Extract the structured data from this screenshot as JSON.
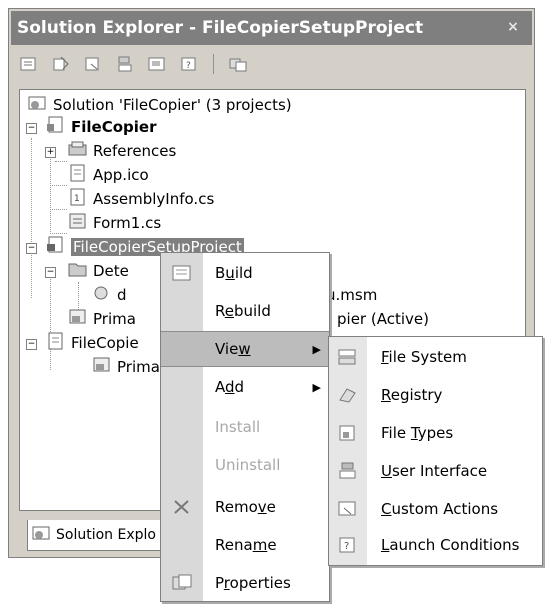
{
  "window": {
    "title": "Solution Explorer - FileCopierSetupProject",
    "close_glyph": "×"
  },
  "toolbar": {
    "icons": [
      "properties-icon",
      "show-all-files-icon",
      "refresh-icon",
      "view-code-icon",
      "view-designer-icon",
      "file-types-icon",
      "launch-conditions-icon"
    ]
  },
  "tree": {
    "solution": "Solution 'FileCopier' (3 projects)",
    "project1": "FileCopier",
    "references": "References",
    "app_ico": "App.ico",
    "assemblyinfo": "AssemblyInfo.cs",
    "form1": "Form1.cs",
    "setup_project": "FileCopierSetupProject",
    "detected": "Dete",
    "dep_item": "d",
    "dep_suffix": "u.msm",
    "primary1": "Prima",
    "primary1_suffix": "pier (Active)",
    "project3": "FileCopie",
    "primary2": "Prima"
  },
  "bottom_tab": {
    "label": "Solution Explo"
  },
  "context_menu": {
    "items": [
      {
        "label": "Build",
        "underline_index": 1,
        "enabled": true
      },
      {
        "label": "Rebuild",
        "underline_index": 1,
        "enabled": true
      },
      {
        "label": "View",
        "underline_index": 3,
        "enabled": true,
        "submenu": true
      },
      {
        "label": "Add",
        "underline_index": 1,
        "enabled": true,
        "submenu": true
      },
      {
        "label": "Install",
        "enabled": false
      },
      {
        "label": "Uninstall",
        "enabled": false
      },
      {
        "label": "Remove",
        "underline_index": 4,
        "enabled": true
      },
      {
        "label": "Rename",
        "underline_index": 4,
        "enabled": true
      },
      {
        "label": "Properties",
        "underline_index": 1,
        "enabled": true
      }
    ]
  },
  "view_submenu": {
    "items": [
      {
        "label": "File System",
        "underline_index": 0
      },
      {
        "label": "Registry",
        "underline_index": 0
      },
      {
        "label": "File Types",
        "underline_index": 5
      },
      {
        "label": "User Interface",
        "underline_index": 0
      },
      {
        "label": "Custom Actions",
        "underline_index": 0
      },
      {
        "label": "Launch Conditions",
        "underline_index": 0
      }
    ]
  },
  "colors": {
    "title_bg": "#7f7f7f",
    "menu_gutter": "#d9d9d9",
    "selection": "#7f7f7f",
    "disabled_text": "#a8a8a8"
  }
}
